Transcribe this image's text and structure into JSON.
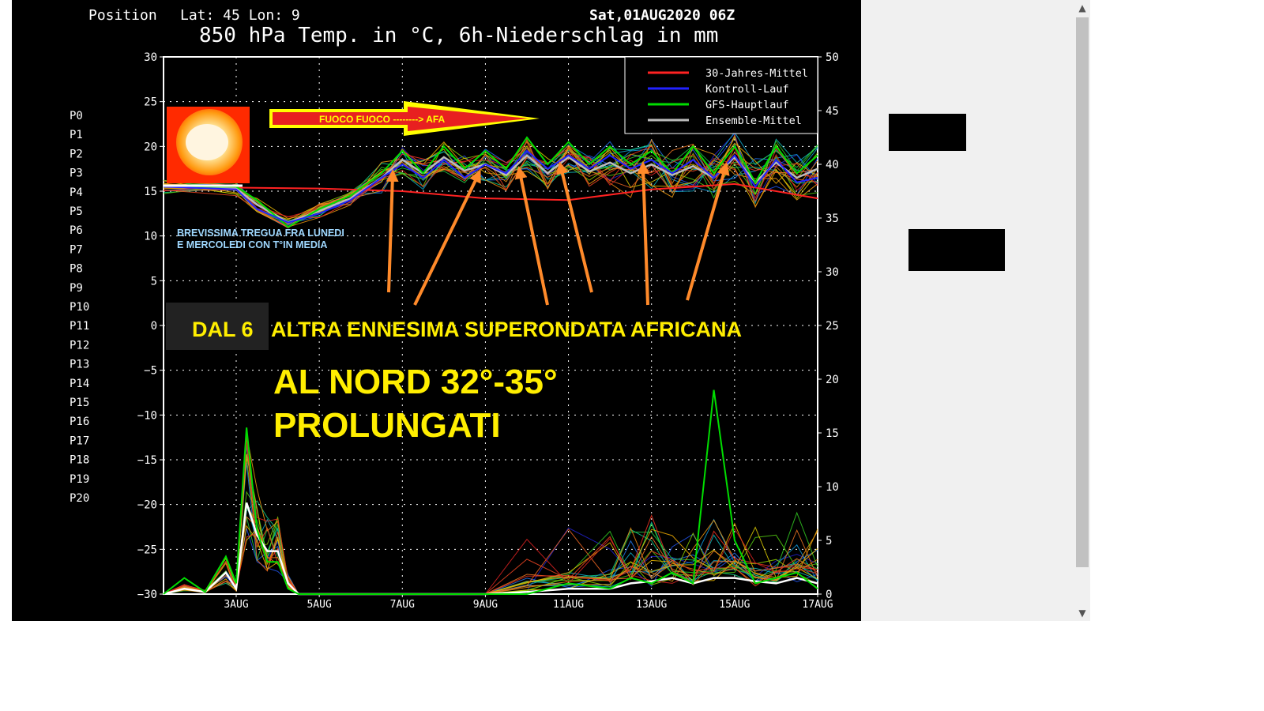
{
  "header": {
    "position_label": "Position",
    "latlon": "Lat: 45 Lon: 9",
    "run": "Sat,01AUG2020 06Z",
    "title": "850 hPa Temp. in °C, 6h-Niederschlag in mm"
  },
  "members": [
    "P0",
    "P1",
    "P2",
    "P3",
    "P4",
    "P5",
    "P6",
    "P7",
    "P8",
    "P9",
    "P10",
    "P11",
    "P12",
    "P13",
    "P14",
    "P15",
    "P16",
    "P17",
    "P18",
    "P19",
    "P20"
  ],
  "member_colors": [
    "#2222cc",
    "#2255ee",
    "#2277ee",
    "#1199dd",
    "#11aacc",
    "#11bbbb",
    "#11cc88",
    "#22cc44",
    "#33cc22",
    "#55cc11",
    "#88cc00",
    "#ddcc00",
    "#eebb00",
    "#eeaa00",
    "#ee9911",
    "#ee8811",
    "#ee7722",
    "#ee6622",
    "#ee4422",
    "#ee3322",
    "#dd2222"
  ],
  "legend": [
    {
      "label": "30-Jahres-Mittel",
      "color": "#ff2222"
    },
    {
      "label": "Kontroll-Lauf",
      "color": "#2222ff"
    },
    {
      "label": "GFS-Hauptlauf",
      "color": "#00dd00"
    },
    {
      "label": "Ensemble-Mittel",
      "color": "#bbbbbb"
    }
  ],
  "annotations": {
    "banner": "FUOCO FUOCO --------> AFA",
    "tregua_line1": "BREVISSIMA TREGUA FRA LUNEDI",
    "tregua_line2": "E MERCOLEDI CON T°IN MEDIA",
    "dal6": "DAL 6",
    "superondata": "ALTRA ENNESIMA SUPERONDATA AFRICANA",
    "nord_line1": "AL NORD 32°-35°",
    "nord_line2": "PROLUNGATI"
  },
  "scroll": {
    "up": "▲",
    "down": "▼"
  },
  "chart_data": {
    "type": "line",
    "title": "850 hPa Temp. in °C, 6h-Niederschlag in mm",
    "x_ticks": [
      "3AUG",
      "5AUG",
      "7AUG",
      "9AUG",
      "11AUG",
      "13AUG",
      "15AUG",
      "17AUG"
    ],
    "x_range_days": [
      1.25,
      17.0
    ],
    "y_left_ticks": [
      30,
      25,
      20,
      15,
      10,
      5,
      0,
      -5,
      -10,
      -15,
      -20,
      -25,
      -30
    ],
    "ylim_left": [
      -30,
      30
    ],
    "y_right_ticks": [
      50,
      45,
      40,
      35,
      30,
      25,
      20,
      15,
      10,
      5,
      0
    ],
    "ylim_right": [
      0,
      50
    ],
    "grid": true,
    "legend_position": "top-right",
    "series": [
      {
        "name": "30-Jahres-Mittel",
        "axis": "left",
        "color": "#ff2222",
        "x": [
          1.25,
          3,
          5,
          7,
          9,
          11,
          13,
          15,
          17
        ],
        "y": [
          15.5,
          15.4,
          15.3,
          15.0,
          14.2,
          14.0,
          15.2,
          15.8,
          14.2
        ]
      },
      {
        "name": "Ensemble-Mittel",
        "axis": "left",
        "color": "#bbbbbb",
        "x": [
          1.25,
          3,
          3.5,
          4.25,
          5,
          5.75,
          6.5,
          7,
          7.5,
          8,
          8.5,
          9,
          9.5,
          10,
          10.5,
          11,
          11.5,
          12,
          12.5,
          13,
          13.5,
          14,
          14.5,
          15,
          15.5,
          16,
          16.5,
          17
        ],
        "y": [
          15.5,
          15.3,
          13.5,
          11.5,
          12.8,
          14.2,
          16.5,
          18.5,
          17.0,
          18.8,
          17.3,
          18.0,
          16.8,
          19.0,
          17.0,
          18.8,
          17.2,
          18.2,
          17.0,
          18.0,
          16.8,
          17.8,
          16.5,
          18.8,
          16.0,
          18.2,
          16.5,
          17.5
        ]
      },
      {
        "name": "GFS-Hauptlauf",
        "axis": "left",
        "color": "#00dd00",
        "x": [
          1.25,
          3,
          3.5,
          4.25,
          5,
          5.75,
          6.5,
          7,
          7.5,
          8,
          8.5,
          9,
          9.5,
          10,
          10.5,
          11,
          11.5,
          12,
          12.5,
          13,
          13.5,
          14,
          14.5,
          15,
          15.5,
          16,
          16.5,
          17
        ],
        "y": [
          15.5,
          15.5,
          14.0,
          11.0,
          13.0,
          14.5,
          17.0,
          19.5,
          17.0,
          20.0,
          17.5,
          19.5,
          17.5,
          21.0,
          18.0,
          20.5,
          18.0,
          20.0,
          18.0,
          19.5,
          17.0,
          20.0,
          17.0,
          20.0,
          16.0,
          20.0,
          17.0,
          19.0
        ]
      },
      {
        "name": "Kontroll-Lauf",
        "axis": "left",
        "color": "#2222ff",
        "x": [
          1.25,
          3,
          3.5,
          4.25,
          5,
          5.75,
          6.5,
          7,
          7.5,
          8,
          8.5,
          9,
          9.5,
          10,
          10.5,
          11,
          11.5,
          12,
          12.5,
          13,
          13.5,
          14,
          14.5,
          15,
          15.5,
          16,
          16.5,
          17
        ],
        "y": [
          15.5,
          15.2,
          13.0,
          11.5,
          12.5,
          14.0,
          16.5,
          18.0,
          16.5,
          18.5,
          16.5,
          18.0,
          17.0,
          19.5,
          17.5,
          19.0,
          17.5,
          19.0,
          17.5,
          18.5,
          17.0,
          18.5,
          16.5,
          19.0,
          15.5,
          18.5,
          16.0,
          16.5
        ]
      },
      {
        "name": "Ensemble-Mittel Niederschlag",
        "axis": "right",
        "color": "#ffffff",
        "x": [
          1.25,
          1.75,
          2.25,
          2.75,
          3.0,
          3.25,
          3.5,
          3.75,
          4.0,
          4.25,
          4.5,
          9,
          10,
          11,
          12,
          12.5,
          13,
          13.5,
          14,
          14.5,
          15,
          15.5,
          16,
          16.5,
          17
        ],
        "y": [
          0,
          0.5,
          0.2,
          2.0,
          0.5,
          8.5,
          5.5,
          4.0,
          4.0,
          1.0,
          0,
          0,
          0.2,
          0.5,
          0.5,
          1.0,
          1.2,
          1.5,
          1.0,
          1.5,
          1.5,
          1.2,
          1.0,
          1.5,
          1.0
        ]
      },
      {
        "name": "GFS-Hauptlauf Niederschlag",
        "axis": "right",
        "color": "#00dd00",
        "x": [
          1.25,
          1.75,
          2.25,
          2.75,
          3.0,
          3.25,
          3.5,
          3.75,
          4.0,
          4.25,
          4.5,
          9,
          10,
          11,
          12,
          12.5,
          13,
          13.5,
          14,
          14.5,
          15,
          15.5,
          16,
          16.5,
          17
        ],
        "y": [
          0,
          1.5,
          0.2,
          3.5,
          1.0,
          15.5,
          6.0,
          3.0,
          3.0,
          0.5,
          0,
          0,
          0,
          1.0,
          0.5,
          1.5,
          1.0,
          2.0,
          1.0,
          19.0,
          5.0,
          1.0,
          1.5,
          2.0,
          0.5
        ]
      }
    ]
  }
}
